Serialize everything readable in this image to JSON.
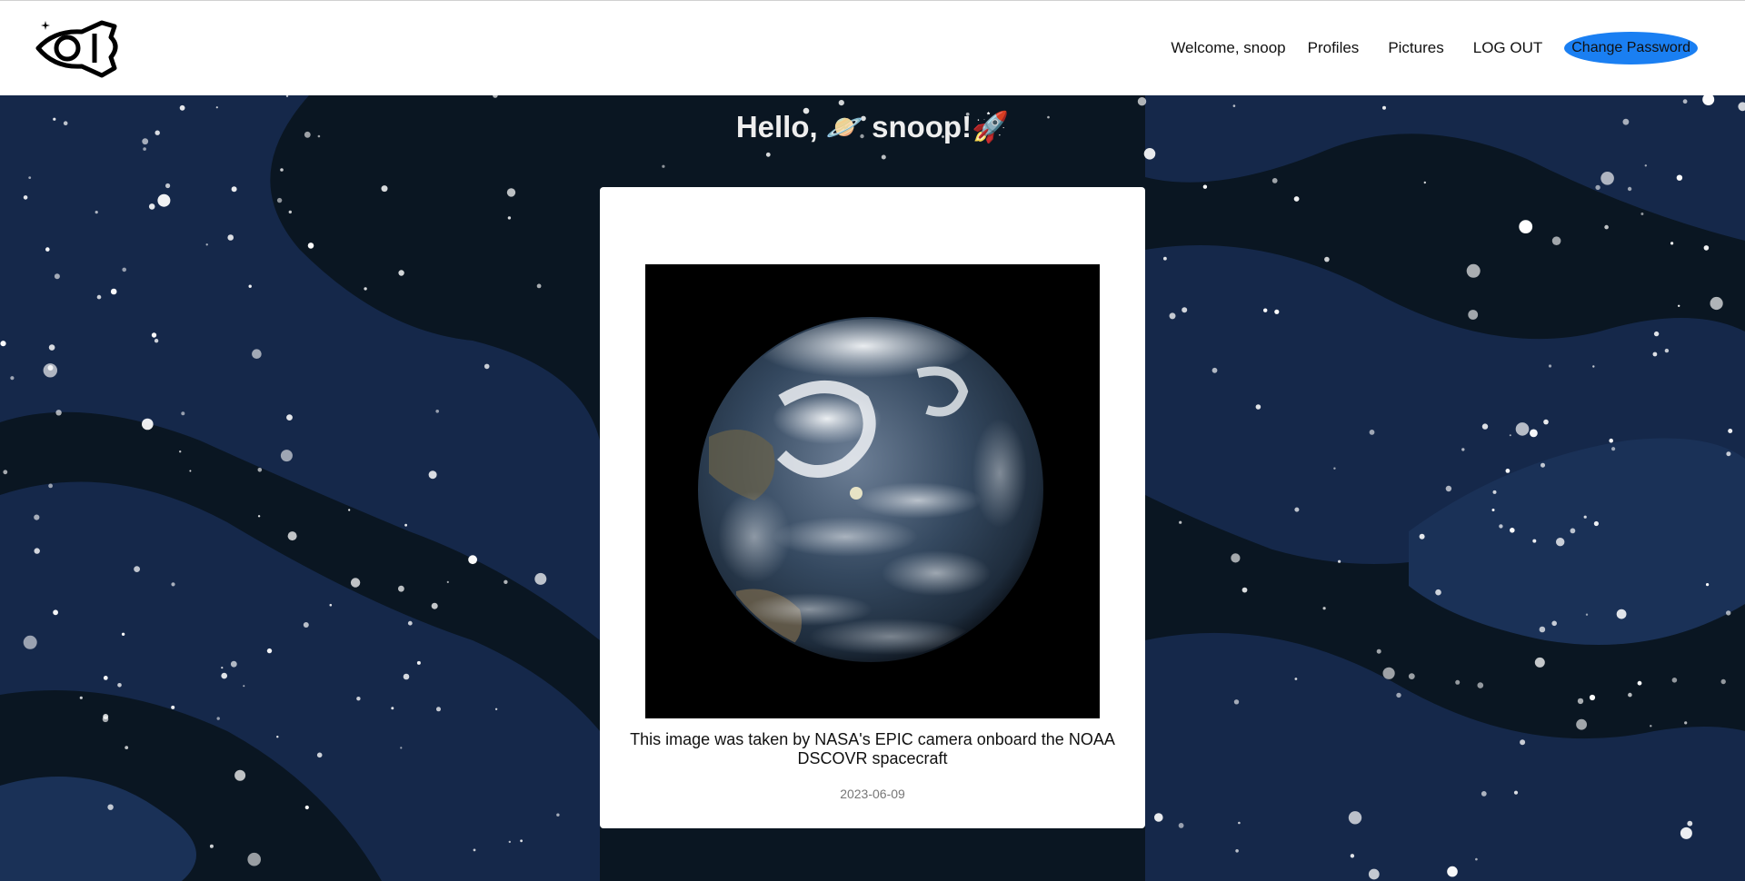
{
  "nav": {
    "logo_name": "rocket-eye-logo",
    "welcome": "Welcome, snoop",
    "profiles": "Profiles",
    "pictures": "Pictures",
    "logout": "LOG OUT",
    "change_password": "Change Password"
  },
  "greeting": {
    "hello": "Hello,",
    "planet_emoji": "🪐",
    "name": "snoop!",
    "rocket_emoji": "🚀"
  },
  "card": {
    "image_alt": "earth-photo",
    "caption": "This image was taken by NASA's EPIC camera onboard the NOAA DSCOVR spacecraft",
    "date": "2023-06-09"
  },
  "colors": {
    "accent": "#1a7ff2",
    "background": "#0c1a2a",
    "wave": "#16294a"
  }
}
